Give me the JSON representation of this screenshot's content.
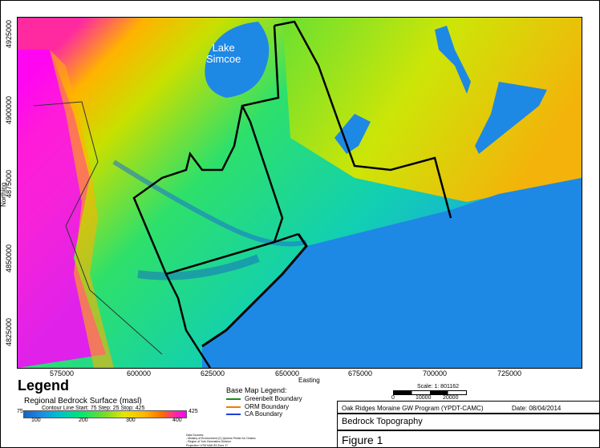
{
  "map": {
    "lake_label": "Lake\nSimcoe",
    "y_axis_title": "Northing",
    "x_axis_title": "Easting",
    "y_ticks": [
      "4925000",
      "4900000",
      "4875000",
      "4850000",
      "4825000"
    ],
    "x_ticks": [
      "575000",
      "600000",
      "625000",
      "650000",
      "675000",
      "700000",
      "725000"
    ]
  },
  "legend": {
    "title": "Legend",
    "subtitle": "Regional Bedrock Surface  (masl)",
    "contour": "Contour Line Start: 75  Step: 25  Stop: 425",
    "ramp_min": "75",
    "ramp_max": "425",
    "ramp_ticks": [
      "100",
      "200",
      "300",
      "400"
    ],
    "colors": {
      "low": "#1565c0",
      "mid": "#7cd92a",
      "high": "#ff00ff"
    }
  },
  "base_map_legend": {
    "title": "Base Map Legend:",
    "items": [
      {
        "label": "Greenbelt Boundary",
        "color": "#1b8a1b"
      },
      {
        "label": "ORM Boundary",
        "color": "#f57c00"
      },
      {
        "label": "CA Boundary",
        "color": "#1e3fd6"
      }
    ]
  },
  "scale": {
    "label": "Scale: 1: 801162",
    "ticks": [
      "0",
      "10000",
      "20000"
    ]
  },
  "title_block": {
    "program": "Oak Ridges Moraine GW Program (YPDT-CAMC)",
    "date": "Date:  08/04/2014",
    "figure_title": "Bedrock Topography",
    "figure_number": "Figure 1"
  },
  "data_sources": "Data Sources:\n- Ministry of Environment (C) Queens Printer for Ontario\n- Region of York Geomatics Division\nProjection: UTM NAD 83 Zone 17"
}
